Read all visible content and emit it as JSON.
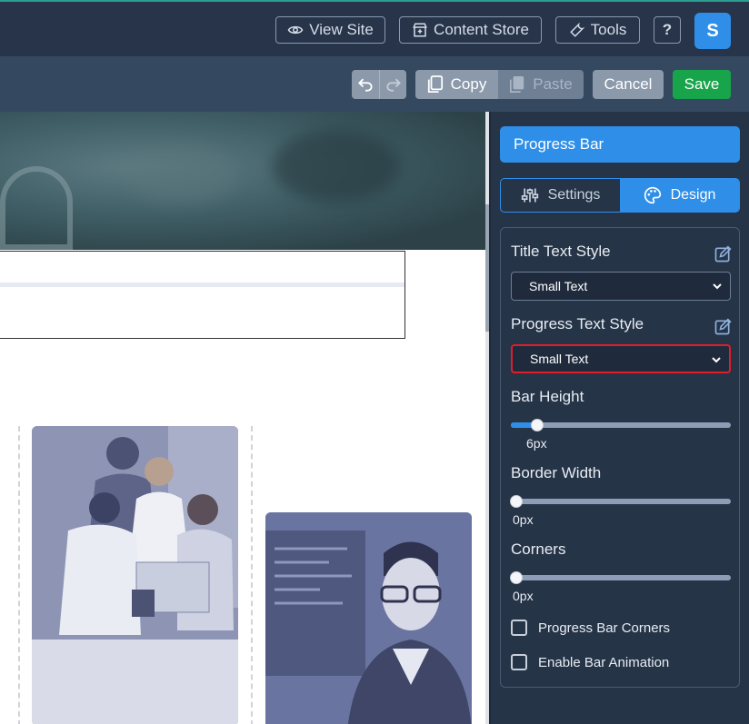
{
  "topbar": {
    "view_site": "View Site",
    "content_store": "Content Store",
    "tools": "Tools",
    "help": "?",
    "avatar_initial": "S",
    "icons": [
      "eye-icon",
      "store-icon",
      "wrench-icon"
    ]
  },
  "toolbar": {
    "copy": "Copy",
    "paste": "Paste",
    "cancel": "Cancel",
    "save": "Save",
    "icons": [
      "undo-icon",
      "redo-icon",
      "copy-icon",
      "paste-icon"
    ]
  },
  "panel": {
    "title": "Progress Bar",
    "tabs": [
      {
        "label": "Settings",
        "icon": "sliders-icon",
        "active": false
      },
      {
        "label": "Design",
        "icon": "palette-icon",
        "active": true
      }
    ],
    "title_text_style": {
      "label": "Title Text Style",
      "value": "Small Text"
    },
    "progress_text_style": {
      "label": "Progress Text Style",
      "value": "Small Text"
    },
    "bar_height": {
      "label": "Bar Height",
      "value": "6px",
      "level": 0.1
    },
    "border_width": {
      "label": "Border Width",
      "value": "0px",
      "level": 0
    },
    "corners": {
      "label": "Corners",
      "value": "0px",
      "level": 0
    },
    "checkboxes": [
      {
        "label": "Progress Bar Corners",
        "checked": false
      },
      {
        "label": "Enable Bar Animation",
        "checked": false
      }
    ]
  },
  "colors": {
    "accent": "#2f8fe8",
    "save": "#17a44a",
    "highlight": "#e11d2a",
    "topbar": "#273449"
  }
}
